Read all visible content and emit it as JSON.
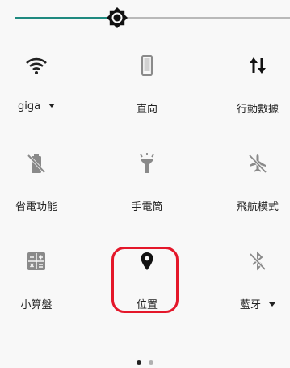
{
  "brightness": {
    "level_percent": 37
  },
  "tiles": [
    {
      "label": "giga",
      "icon": "wifi-icon",
      "has_dropdown": true
    },
    {
      "label": "直向",
      "icon": "phone-portrait-icon",
      "has_dropdown": false
    },
    {
      "label": "行動數據",
      "icon": "mobile-data-icon",
      "has_dropdown": false
    },
    {
      "label": "省電功能",
      "icon": "battery-saver-icon",
      "has_dropdown": false
    },
    {
      "label": "手電筒",
      "icon": "flashlight-icon",
      "has_dropdown": false
    },
    {
      "label": "飛航模式",
      "icon": "airplane-icon",
      "has_dropdown": false
    },
    {
      "label": "小算盤",
      "icon": "calculator-icon",
      "has_dropdown": false
    },
    {
      "label": "位置",
      "icon": "location-pin-icon",
      "has_dropdown": false
    },
    {
      "label": "藍牙",
      "icon": "bluetooth-icon",
      "has_dropdown": true
    }
  ],
  "highlight": {
    "target": "位置",
    "color": "#e4172a"
  },
  "pager": {
    "page_count": 2,
    "current_page": 1
  },
  "colors": {
    "slider_active": "#1f8a80",
    "icon": "#222222",
    "icon_dim": "#8a8a8a"
  }
}
